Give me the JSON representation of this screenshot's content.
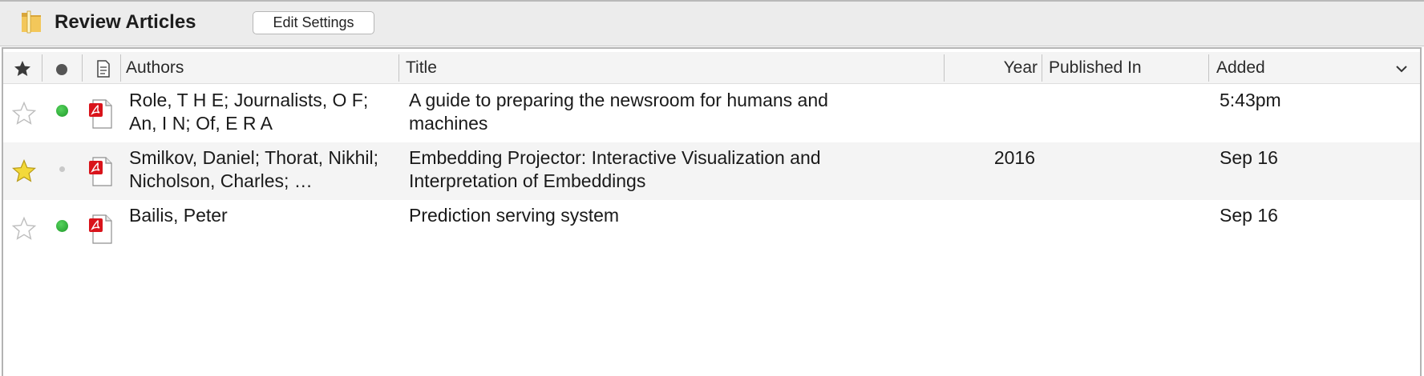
{
  "toolbar": {
    "collection_icon": "folder-icon",
    "title": "Review Articles",
    "edit_button": "Edit Settings"
  },
  "table": {
    "columns": {
      "flag_icon": "star-icon",
      "read_icon": "dot-icon",
      "file_icon": "document-icon",
      "authors": "Authors",
      "title": "Title",
      "year": "Year",
      "published_in": "Published In",
      "added": "Added",
      "menu_icon": "chevron-down-icon"
    },
    "rows": [
      {
        "starred": false,
        "read_status": "unread-green",
        "file_icon": "pdf-icon",
        "authors": "Role, T H E; Journalists, O F; An, I N; Of, E R A",
        "title": "A guide to preparing the newsroom for humans and machines",
        "year": "",
        "published_in": "",
        "added": "5:43pm"
      },
      {
        "starred": true,
        "read_status": "read-grey",
        "file_icon": "pdf-icon",
        "authors": "Smilkov, Daniel; Thorat, Nikhil; Nicholson, Charles; …",
        "title": "Embedding Projector: Interactive Visualization and Interpretation of Embeddings",
        "year": "2016",
        "published_in": "",
        "added": "Sep 16"
      },
      {
        "starred": false,
        "read_status": "unread-green",
        "file_icon": "pdf-icon",
        "authors": "Bailis, Peter",
        "title": "Prediction serving system",
        "year": "",
        "published_in": "",
        "added": "Sep 16"
      }
    ]
  },
  "colors": {
    "star_filled": "#f3d93a",
    "read_dot": "#2fae3a",
    "pdf_red": "#d9141b",
    "alt_row": "#f4f4f4"
  }
}
